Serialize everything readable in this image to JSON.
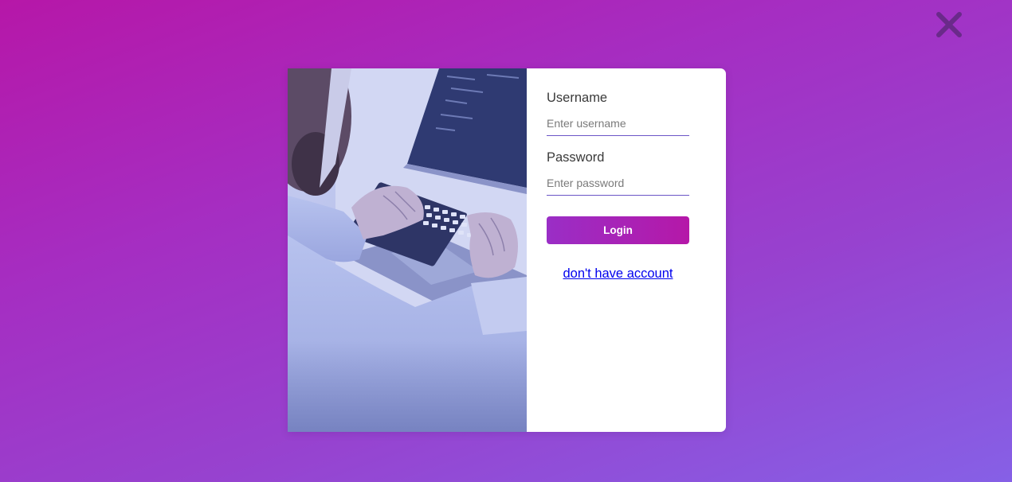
{
  "close_icon": "close-icon",
  "colors": {
    "background_gradient_start": "#b617a8",
    "background_gradient_end": "#8660e6",
    "button_gradient_start": "#9a2ec6",
    "button_gradient_end": "#b518a8",
    "input_underline": "#6b55c6",
    "link": "#0000ee"
  },
  "form": {
    "username_label": "Username",
    "username_placeholder": "Enter username",
    "username_value": "",
    "password_label": "Password",
    "password_placeholder": "Enter password",
    "password_value": "",
    "login_label": "Login",
    "signup_link": "don't have account"
  }
}
